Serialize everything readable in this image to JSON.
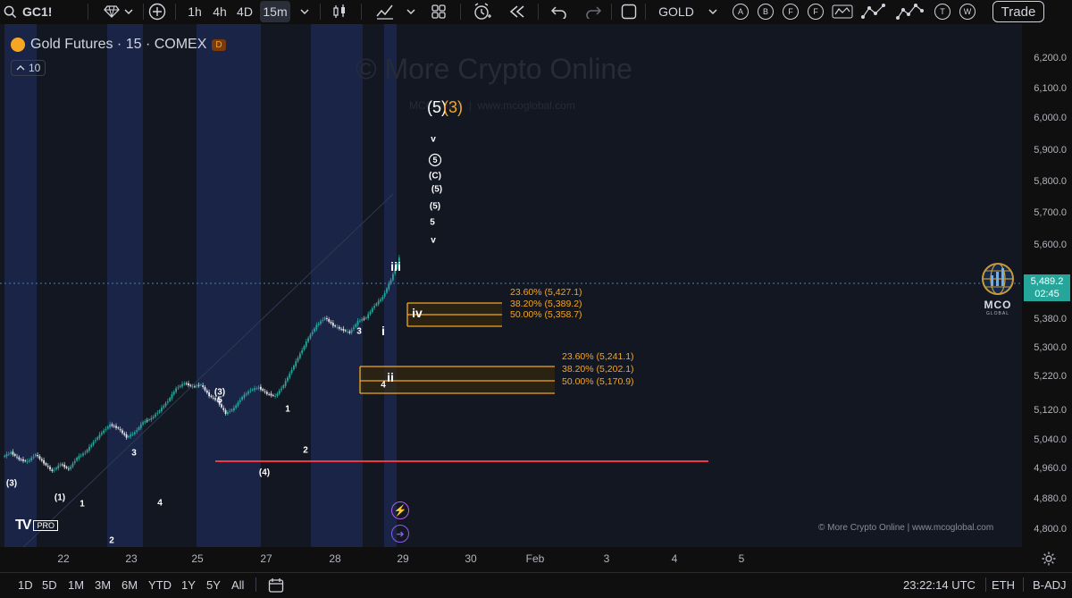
{
  "toolbar": {
    "symbol": "GC1!",
    "intervals": [
      "1h",
      "4h",
      "4D",
      "15m"
    ],
    "active_interval": "15m",
    "symbol_search": "GOLD",
    "tool_letters": [
      "A",
      "B",
      "F",
      "F",
      "T",
      "W"
    ],
    "trade_label": "Trade"
  },
  "legend": {
    "title": "Gold Futures · 15 · COMEX",
    "badge": "D",
    "indicator_count": "10"
  },
  "watermark": {
    "main": "© More Crypto Online",
    "sub": "MCOglobal  |  www.mcoglobal.com",
    "footer": "© More Crypto Online  |  www.mcoglobal.com"
  },
  "chart_data": {
    "type": "line",
    "title": "Gold Futures · 15 · COMEX",
    "x_ticks": [
      "22",
      "23",
      "25",
      "27",
      "28",
      "29",
      "30",
      "Feb",
      "3",
      "4",
      "5"
    ],
    "y_ticks": [
      "6,200.0",
      "6,100.0",
      "6,000.0",
      "5,900.0",
      "5,800.0",
      "5,700.0",
      "5,600.0",
      "5,380.0",
      "5,300.0",
      "5,220.0",
      "5,120.0",
      "5,040.0",
      "4,960.0",
      "4,880.0",
      "4,800.0"
    ],
    "last_price": "5,489.2",
    "countdown": "02:45",
    "support_level": 4985,
    "series": [
      {
        "values": [
          4858,
          4872,
          4850,
          4842,
          4866,
          4838,
          4812,
          4835,
          4818,
          4855,
          4872,
          4905,
          4935,
          4960,
          4948,
          4920,
          4935,
          4968,
          4980,
          5005,
          5035,
          5075,
          5092,
          5080,
          5087,
          5052,
          5035,
          4995,
          5012,
          5048,
          5070,
          5078,
          5058,
          5050,
          5085,
          5135,
          5185,
          5235,
          5275,
          5300,
          5275,
          5262,
          5252,
          5288,
          5300,
          5338,
          5365,
          5420,
          5489
        ]
      }
    ],
    "fib_zones": [
      {
        "lines": [
          "23.60% (5,427.1)",
          "38.20% (5,389.2)",
          "50.00% (5,358.7)"
        ],
        "wave": "iv"
      },
      {
        "lines": [
          "23.60% (5,241.1)",
          "38.20% (5,202.1)",
          "50.00% (5,170.9)"
        ],
        "wave": "ii"
      }
    ],
    "wave_labels": [
      "(3)",
      "(1)",
      "1",
      "2",
      "3",
      "4",
      "(3)",
      "5",
      "(4)",
      "1",
      "2",
      "3",
      "4",
      "i",
      "ii",
      "iii",
      "iv"
    ],
    "target_stack": [
      "(5)",
      "(3)",
      "v",
      "5",
      "(C)",
      "(5)",
      "(5)",
      "5",
      "v"
    ]
  },
  "time_axis_settings": "gear-icon",
  "bottombar": {
    "ranges": [
      "1D",
      "5D",
      "1M",
      "3M",
      "6M",
      "YTD",
      "1Y",
      "5Y",
      "All"
    ],
    "clock": "23:22:14 UTC",
    "session": "ETH",
    "adjust": "B-ADJ"
  },
  "logos": {
    "tradingview": "PRO",
    "mco": "MCO",
    "mco_sub": "GLOBAL"
  },
  "colors": {
    "background": "#131722",
    "candle_up": "#26a69a",
    "fib": "#f5a623",
    "support": "#f23645",
    "price_badge": "#26a69a"
  }
}
